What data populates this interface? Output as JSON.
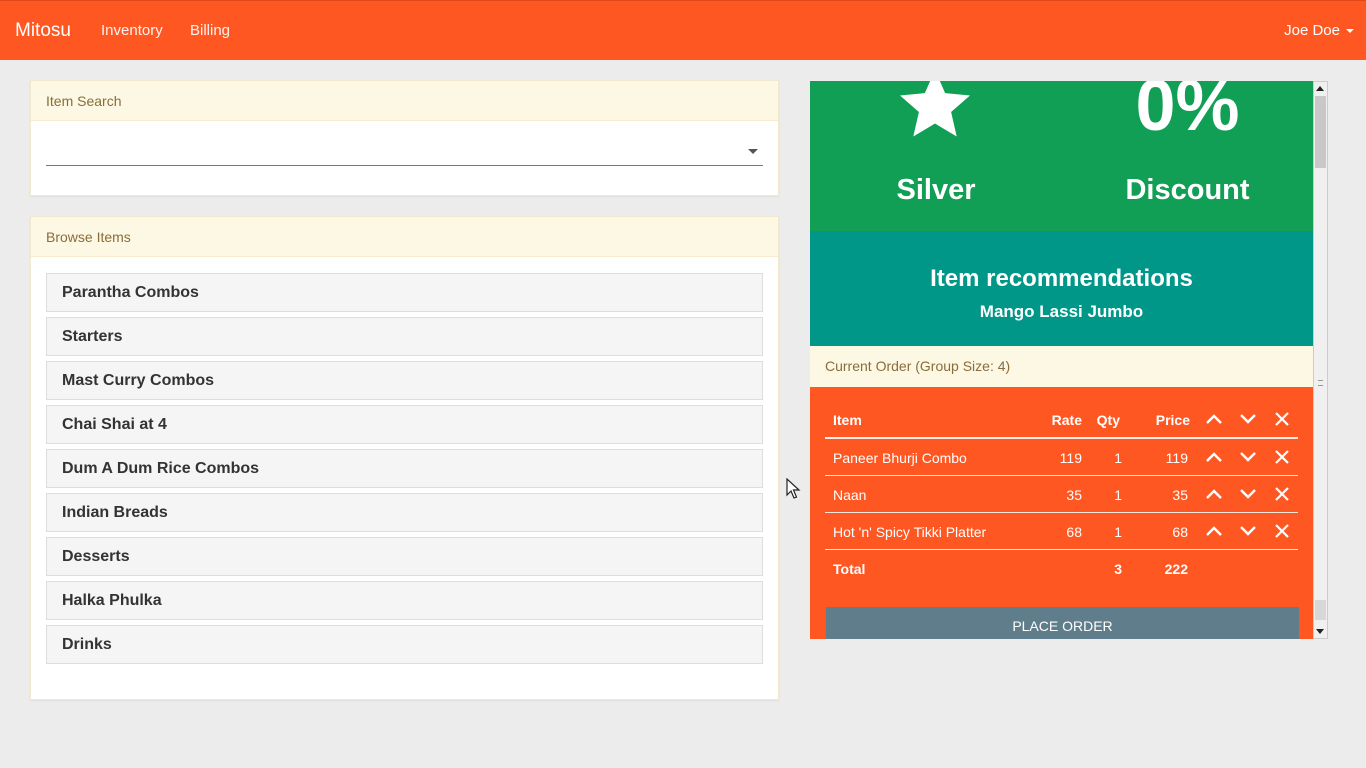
{
  "navbar": {
    "brand": "Mitosu",
    "links": [
      "Inventory",
      "Billing"
    ],
    "user": "Joe Doe"
  },
  "item_search": {
    "heading": "Item Search",
    "value": ""
  },
  "browse": {
    "heading": "Browse Items",
    "categories": [
      "Parantha Combos",
      "Starters",
      "Mast Curry Combos",
      "Chai Shai at 4",
      "Dum A Dum Rice Combos",
      "Indian Breads",
      "Desserts",
      "Halka Phulka",
      "Drinks"
    ]
  },
  "loyalty": {
    "tier": "Silver",
    "tier_icon": "star-icon",
    "discount_value": "0%",
    "discount_label": "Discount",
    "color": "#119f55"
  },
  "recommendations": {
    "title": "Item recommendations",
    "item": "Mango Lassi Jumbo",
    "color": "#009688"
  },
  "order": {
    "heading": "Current Order (Group Size: 4)",
    "columns": {
      "item": "Item",
      "rate": "Rate",
      "qty": "Qty",
      "price": "Price"
    },
    "rows": [
      {
        "item": "Paneer Bhurji Combo",
        "rate": "119",
        "qty": "1",
        "price": "119"
      },
      {
        "item": "Naan",
        "rate": "35",
        "qty": "1",
        "price": "35"
      },
      {
        "item": "Hot 'n' Spicy Tikki Platter",
        "rate": "68",
        "qty": "1",
        "price": "68"
      }
    ],
    "total": {
      "label": "Total",
      "qty": "3",
      "price": "222"
    },
    "place_order_label": "PLACE ORDER",
    "color": "#ff5722"
  },
  "icons": {
    "move_up": "chevron-up-icon",
    "move_down": "chevron-down-icon",
    "remove": "close-icon"
  }
}
